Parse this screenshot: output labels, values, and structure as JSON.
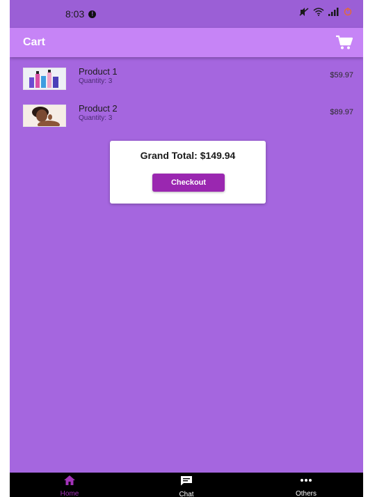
{
  "status_bar": {
    "time": "8:03",
    "notification_count": "!"
  },
  "app_bar": {
    "title": "Cart"
  },
  "cart": {
    "items": [
      {
        "name": "Product 1",
        "quantity": "Quantity: 3",
        "price": "$59.97"
      },
      {
        "name": "Product 2",
        "quantity": "Quantity: 3",
        "price": "$89.97"
      }
    ],
    "grand_total": "Grand Total: $149.94",
    "checkout_label": "Checkout"
  },
  "bottom_nav": {
    "items": [
      {
        "label": "Home",
        "active": true
      },
      {
        "label": "Chat",
        "active": false
      },
      {
        "label": "Others",
        "active": false
      }
    ]
  },
  "colors": {
    "background": "#a566df",
    "app_bar": "#c684f6",
    "accent": "#9a27b0",
    "nav_bar": "#000000"
  },
  "icons": [
    "cart-icon",
    "home-icon",
    "chat-icon",
    "more-icon",
    "mute-icon",
    "wifi-icon",
    "signal-icon",
    "battery-icon"
  ]
}
